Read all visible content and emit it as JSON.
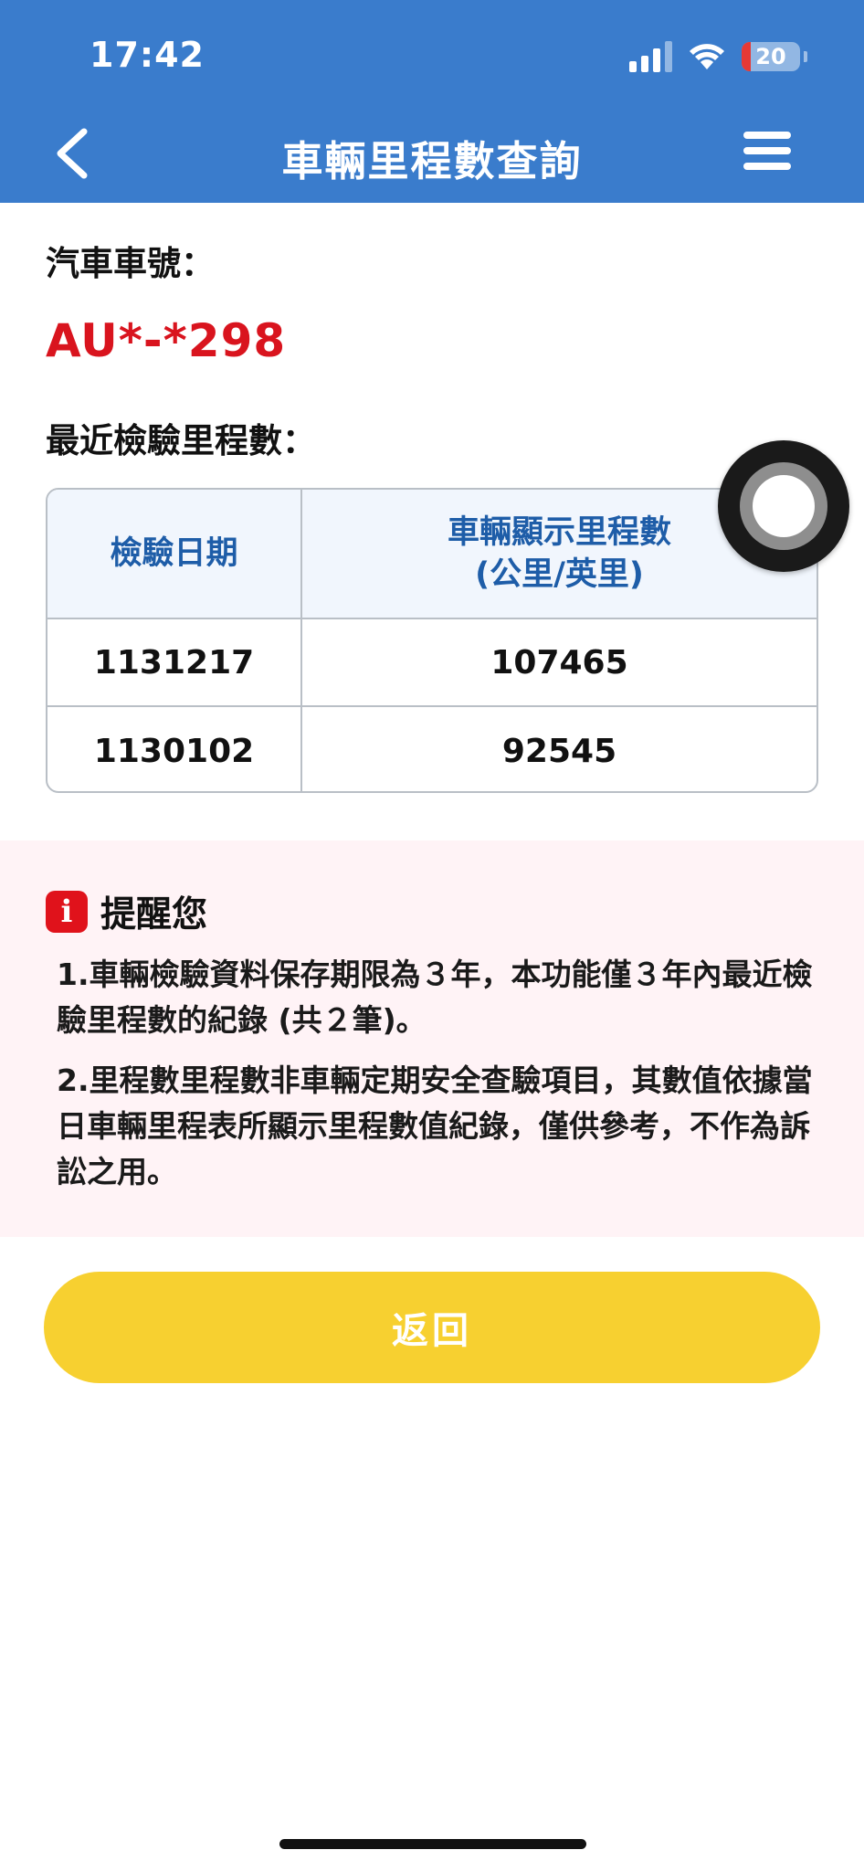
{
  "status_bar": {
    "time": "17:42",
    "battery": "20"
  },
  "nav": {
    "title": "車輛里程數查詢"
  },
  "vehicle": {
    "plate_label": "汽車車號：",
    "plate_value": "AU*-*298"
  },
  "mileage": {
    "section_label": "最近檢驗里程數：",
    "columns": [
      "檢驗日期",
      "車輛顯示里程數",
      "(公里/英里)"
    ],
    "rows": [
      {
        "date": "1131217",
        "mileage": "107465"
      },
      {
        "date": "1130102",
        "mileage": "92545"
      }
    ]
  },
  "reminder": {
    "title": "提醒您",
    "note1": "1.車輛檢驗資料保存期限為３年，本功能僅３年內最近檢驗里程數的紀錄 (共２筆)。",
    "note2": "2.里程數里程數非車輛定期安全查驗項目，其數值依據當日車輛里程表所顯示里程數值紀錄，僅供參考，不作為訴訟之用。"
  },
  "back_button": {
    "label": "返回"
  },
  "colors": {
    "header": "#3a7ccc",
    "plate": "#d9141e",
    "button": "#f7d030",
    "reminder_bg": "#fff3f6"
  },
  "icons": [
    "back-chevron-icon",
    "hamburger-menu-icon",
    "info-icon",
    "signal-icon",
    "wifi-icon",
    "battery-icon"
  ]
}
